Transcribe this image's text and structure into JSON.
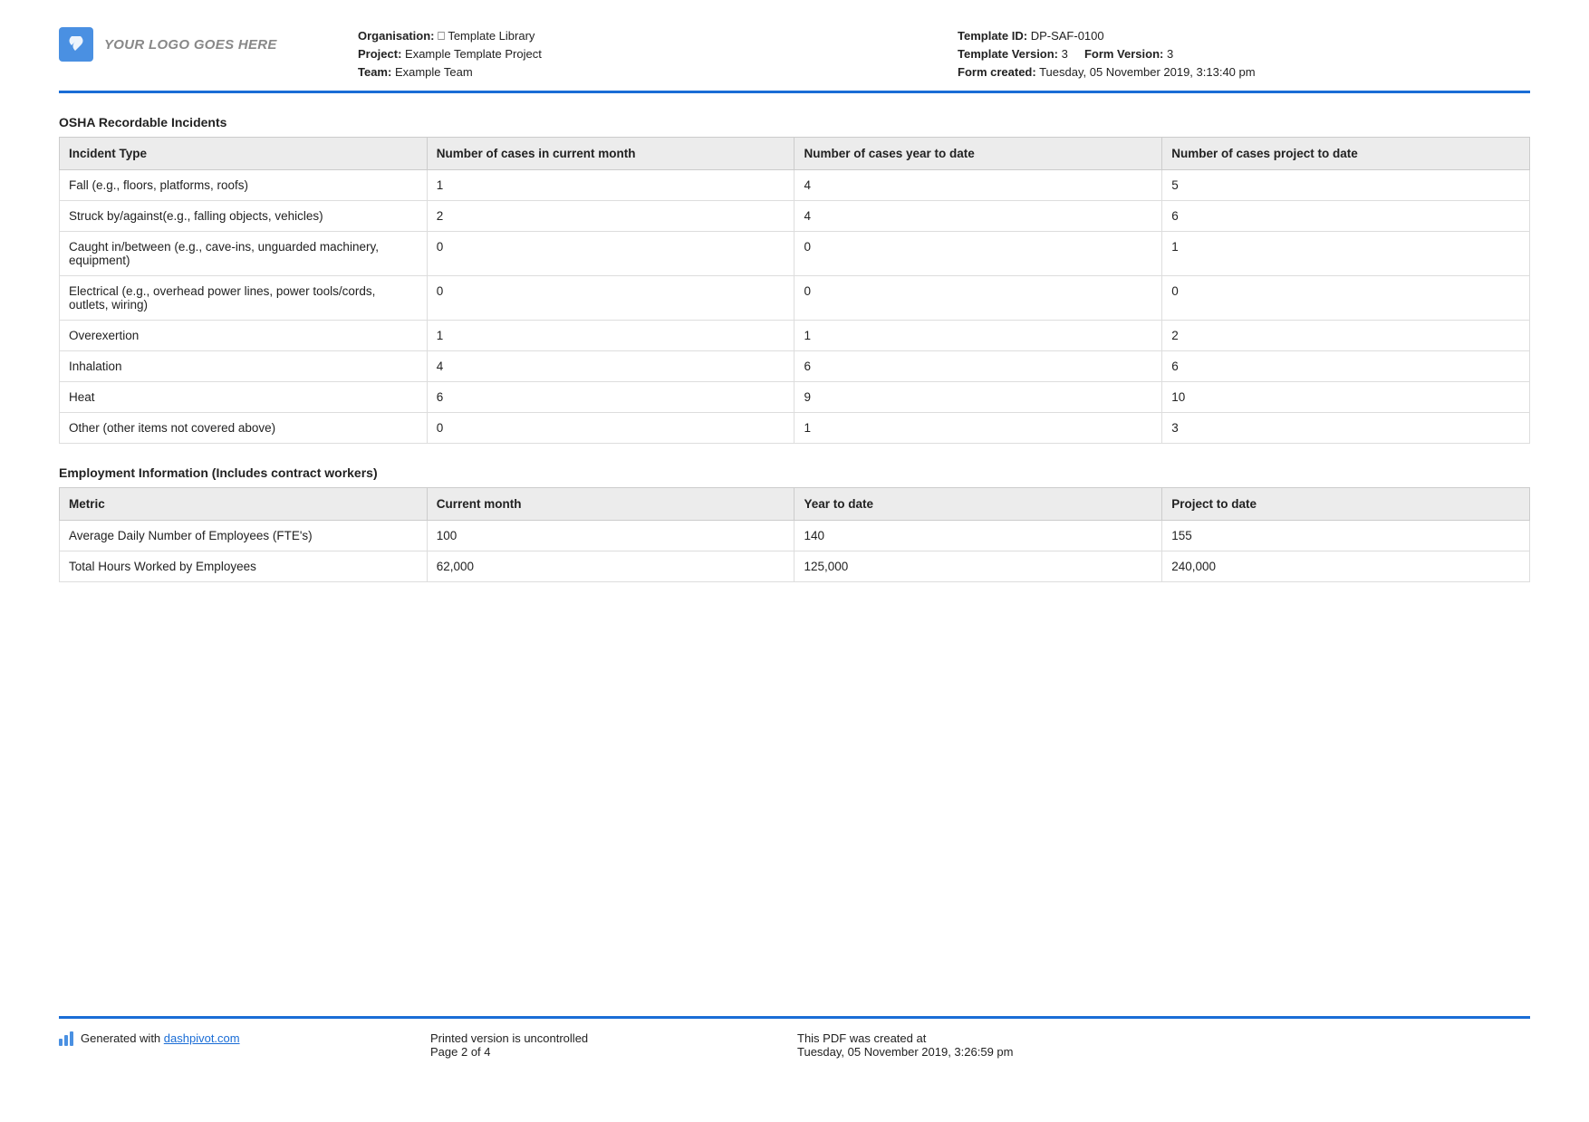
{
  "logo_placeholder": "YOUR LOGO GOES HERE",
  "header_left": {
    "organisation_label": "Organisation:",
    "organisation_value": "⎕ Template Library",
    "project_label": "Project:",
    "project_value": "Example Template Project",
    "team_label": "Team:",
    "team_value": "Example Team"
  },
  "header_right": {
    "template_id_label": "Template ID:",
    "template_id_value": "DP-SAF-0100",
    "template_version_label": "Template Version:",
    "template_version_value": "3",
    "form_version_label": "Form Version:",
    "form_version_value": "3",
    "form_created_label": "Form created:",
    "form_created_value": "Tuesday, 05 November 2019, 3:13:40 pm"
  },
  "section1_title": "OSHA Recordable Incidents",
  "table1": {
    "headers": [
      "Incident Type",
      "Number of cases in current month",
      "Number of cases year to date",
      "Number of cases project to date"
    ],
    "rows": [
      [
        "Fall (e.g., floors, platforms, roofs)",
        "1",
        "4",
        "5"
      ],
      [
        "Struck by/against(e.g., falling objects, vehicles)",
        "2",
        "4",
        "6"
      ],
      [
        "Caught in/between (e.g., cave-ins, unguarded machinery, equipment)",
        "0",
        "0",
        "1"
      ],
      [
        "Electrical (e.g., overhead power lines, power tools/cords, outlets, wiring)",
        "0",
        "0",
        "0"
      ],
      [
        "Overexertion",
        "1",
        "1",
        "2"
      ],
      [
        "Inhalation",
        "4",
        "6",
        "6"
      ],
      [
        "Heat",
        "6",
        "9",
        "10"
      ],
      [
        "Other (other items not covered above)",
        "0",
        "1",
        "3"
      ]
    ]
  },
  "section2_title": "Employment Information (Includes contract workers)",
  "table2": {
    "headers": [
      "Metric",
      "Current month",
      "Year to date",
      "Project to date"
    ],
    "rows": [
      [
        "Average Daily Number of Employees (FTE's)",
        "100",
        "140",
        "155"
      ],
      [
        "Total Hours Worked by Employees",
        "62,000",
        "125,000",
        "240,000"
      ]
    ]
  },
  "footer": {
    "generated_with": "Generated with ",
    "dashpivot_link": "dashpivot.com",
    "printed_text": "Printed version is uncontrolled",
    "page_text": "Page 2 of 4",
    "created_text": "This PDF was created at",
    "created_date": "Tuesday, 05 November 2019, 3:26:59 pm"
  }
}
